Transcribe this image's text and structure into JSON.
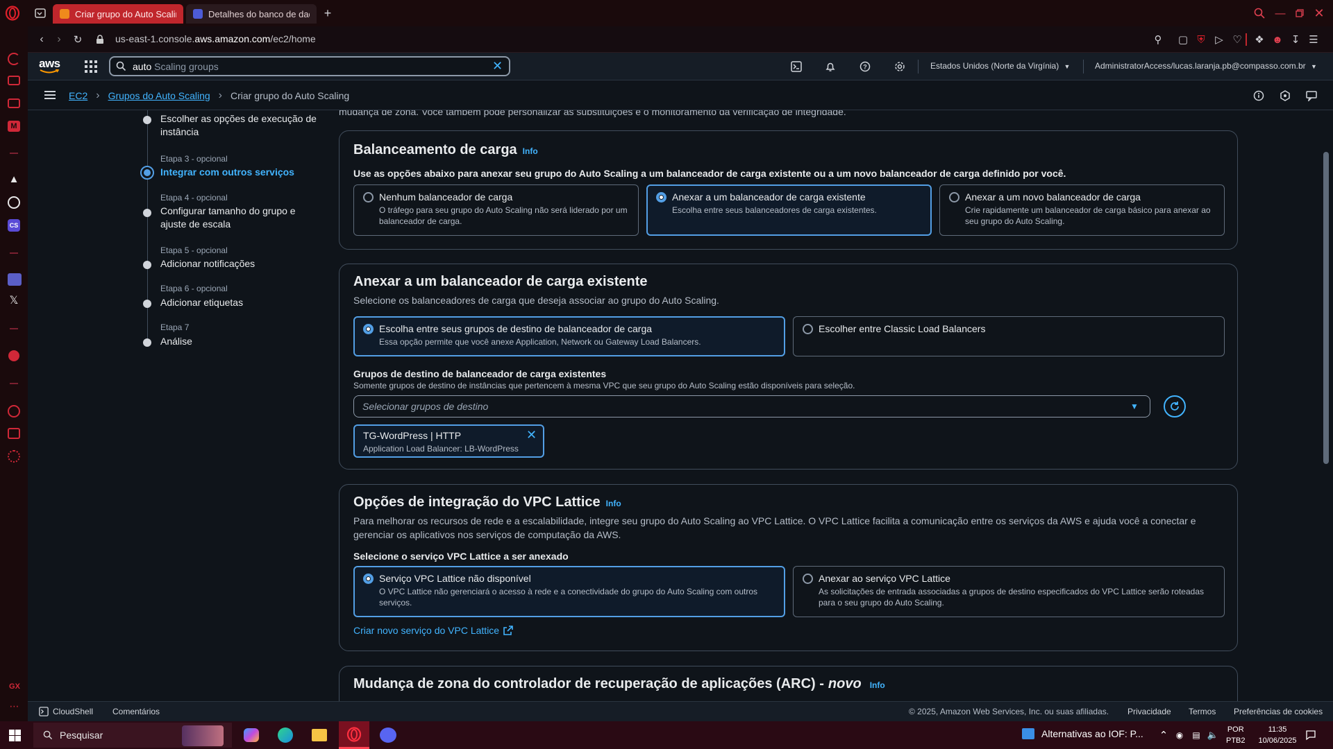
{
  "browser": {
    "tabs": [
      {
        "label": "Criar grupo do Auto Scalin",
        "active": true
      },
      {
        "label": "Detalhes do banco de dad",
        "active": false
      }
    ],
    "url_prefix": "us-east-1.console.",
    "url_domain": "aws.amazon.com",
    "url_suffix": "/ec2/home"
  },
  "aws_header": {
    "logo": "aws",
    "search_value": "auto",
    "search_hint": "Scaling groups",
    "region": "Estados Unidos (Norte da Virgínia)",
    "account": "AdministratorAccess/lucas.laranja.pb@compasso.com.br"
  },
  "breadcrumb": {
    "items": [
      "EC2",
      "Grupos do Auto Scaling"
    ],
    "current": "Criar grupo do Auto Scaling"
  },
  "steps": [
    {
      "etapa": "",
      "title": "Escolher as opções de execução de instância",
      "state": "done"
    },
    {
      "etapa": "Etapa 3 - opcional",
      "title": "Integrar com outros serviços",
      "state": "current"
    },
    {
      "etapa": "Etapa 4 - opcional",
      "title": "Configurar tamanho do grupo e ajuste de escala",
      "state": "todo"
    },
    {
      "etapa": "Etapa 5 - opcional",
      "title": "Adicionar notificações",
      "state": "todo"
    },
    {
      "etapa": "Etapa 6 - opcional",
      "title": "Adicionar etiquetas",
      "state": "todo"
    },
    {
      "etapa": "Etapa 7",
      "title": "Análise",
      "state": "todo"
    }
  ],
  "top_cut_text": "mudança de zona. Você também pode personalizar as substituições e o monitoramento da verificação de integridade.",
  "lb_panel": {
    "title": "Balanceamento de carga",
    "info": "Info",
    "desc": "Use as opções abaixo para anexar seu grupo do Auto Scaling a um balanceador de carga existente ou a um novo balanceador de carga definido por você.",
    "options": [
      {
        "label": "Nenhum balanceador de carga",
        "desc": "O tráfego para seu grupo do Auto Scaling não será liderado por um balanceador de carga.",
        "selected": false
      },
      {
        "label": "Anexar a um balanceador de carga existente",
        "desc": "Escolha entre seus balanceadores de carga existentes.",
        "selected": true
      },
      {
        "label": "Anexar a um novo balanceador de carga",
        "desc": "Crie rapidamente um balanceador de carga básico para anexar ao seu grupo do Auto Scaling.",
        "selected": false
      }
    ]
  },
  "attach_panel": {
    "title": "Anexar a um balanceador de carga existente",
    "desc": "Selecione os balanceadores de carga que deseja associar ao grupo do Auto Scaling.",
    "options": [
      {
        "label": "Escolha entre seus grupos de destino de balanceador de carga",
        "desc": "Essa opção permite que você anexe Application, Network ou Gateway Load Balancers.",
        "selected": true
      },
      {
        "label": "Escolher entre Classic Load Balancers",
        "desc": "",
        "selected": false
      }
    ],
    "field_label": "Grupos de destino de balanceador de carga existentes",
    "field_desc": "Somente grupos de destino de instâncias que pertencem à mesma VPC que seu grupo do Auto Scaling estão disponíveis para seleção.",
    "select_placeholder": "Selecionar grupos de destino",
    "token_title": "TG-WordPress | HTTP",
    "token_desc": "Application Load Balancer: LB-WordPress"
  },
  "vpc_panel": {
    "title": "Opções de integração do VPC Lattice",
    "info": "Info",
    "desc": "Para melhorar os recursos de rede e a escalabilidade, integre seu grupo do Auto Scaling ao VPC Lattice. O VPC Lattice facilita a comunicação entre os serviços da AWS e ajuda você a conectar e gerenciar os aplicativos nos serviços de computação da AWS.",
    "field_label": "Selecione o serviço VPC Lattice a ser anexado",
    "options": [
      {
        "label": "Serviço VPC Lattice não disponível",
        "desc": "O VPC Lattice não gerenciará o acesso à rede e a conectividade do grupo do Auto Scaling com outros serviços.",
        "selected": true
      },
      {
        "label": "Anexar ao serviço VPC Lattice",
        "desc": "As solicitações de entrada associadas a grupos de destino especificados do VPC Lattice serão roteadas para o seu grupo do Auto Scaling.",
        "selected": false
      }
    ],
    "create_link": "Criar novo serviço do VPC Lattice"
  },
  "arc_panel": {
    "title": "Mudança de zona do controlador de recuperação de aplicações (ARC) -",
    "badge": "novo",
    "info": "Info"
  },
  "footer": {
    "cloudshell": "CloudShell",
    "comments": "Comentários",
    "copyright": "© 2025, Amazon Web Services, Inc. ou suas afiliadas.",
    "privacy": "Privacidade",
    "terms": "Termos",
    "cookies": "Preferências de cookies"
  },
  "taskbar": {
    "search": "Pesquisar",
    "news": "Alternativas ao IOF: P...",
    "lang1": "POR",
    "lang2": "PTB2",
    "time": "11:35",
    "date": "10/06/2025"
  },
  "colors": {
    "accent": "#539fe5",
    "link": "#42b4ff",
    "opera_red": "#c0262c"
  }
}
